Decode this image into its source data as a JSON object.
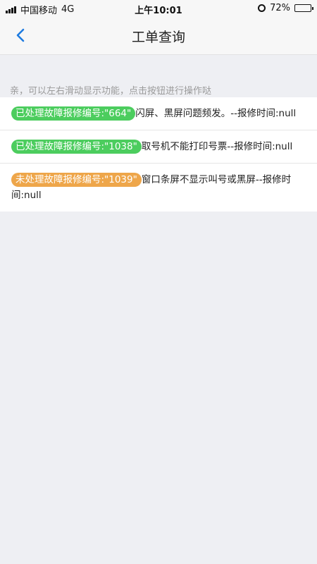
{
  "status": {
    "carrier": "中国移动",
    "network": "4G",
    "time": "上午10:01",
    "battery": "72%",
    "battery_level": 0.72
  },
  "navbar": {
    "title": "工单查询"
  },
  "hint": "亲，可以左右滑动显示功能，点击按钮进行操作哒",
  "items": [
    {
      "badge": "已处理故障报修编号:\"664\"",
      "status": "done",
      "text": "闪屏、黑屏问题频发。--报修时间:null"
    },
    {
      "badge": "已处理故障报修编号:\"1038\"",
      "status": "done",
      "text": "取号机不能打印号票--报修时间:null"
    },
    {
      "badge": "未处理故障报修编号:\"1039\"",
      "status": "todo",
      "text": "窗口条屏不显示叫号或黑屏--报修时间:null"
    }
  ],
  "colors": {
    "processed": "#4ccd5e",
    "unprocessed": "#eea64a",
    "accent": "#1e7be0"
  }
}
